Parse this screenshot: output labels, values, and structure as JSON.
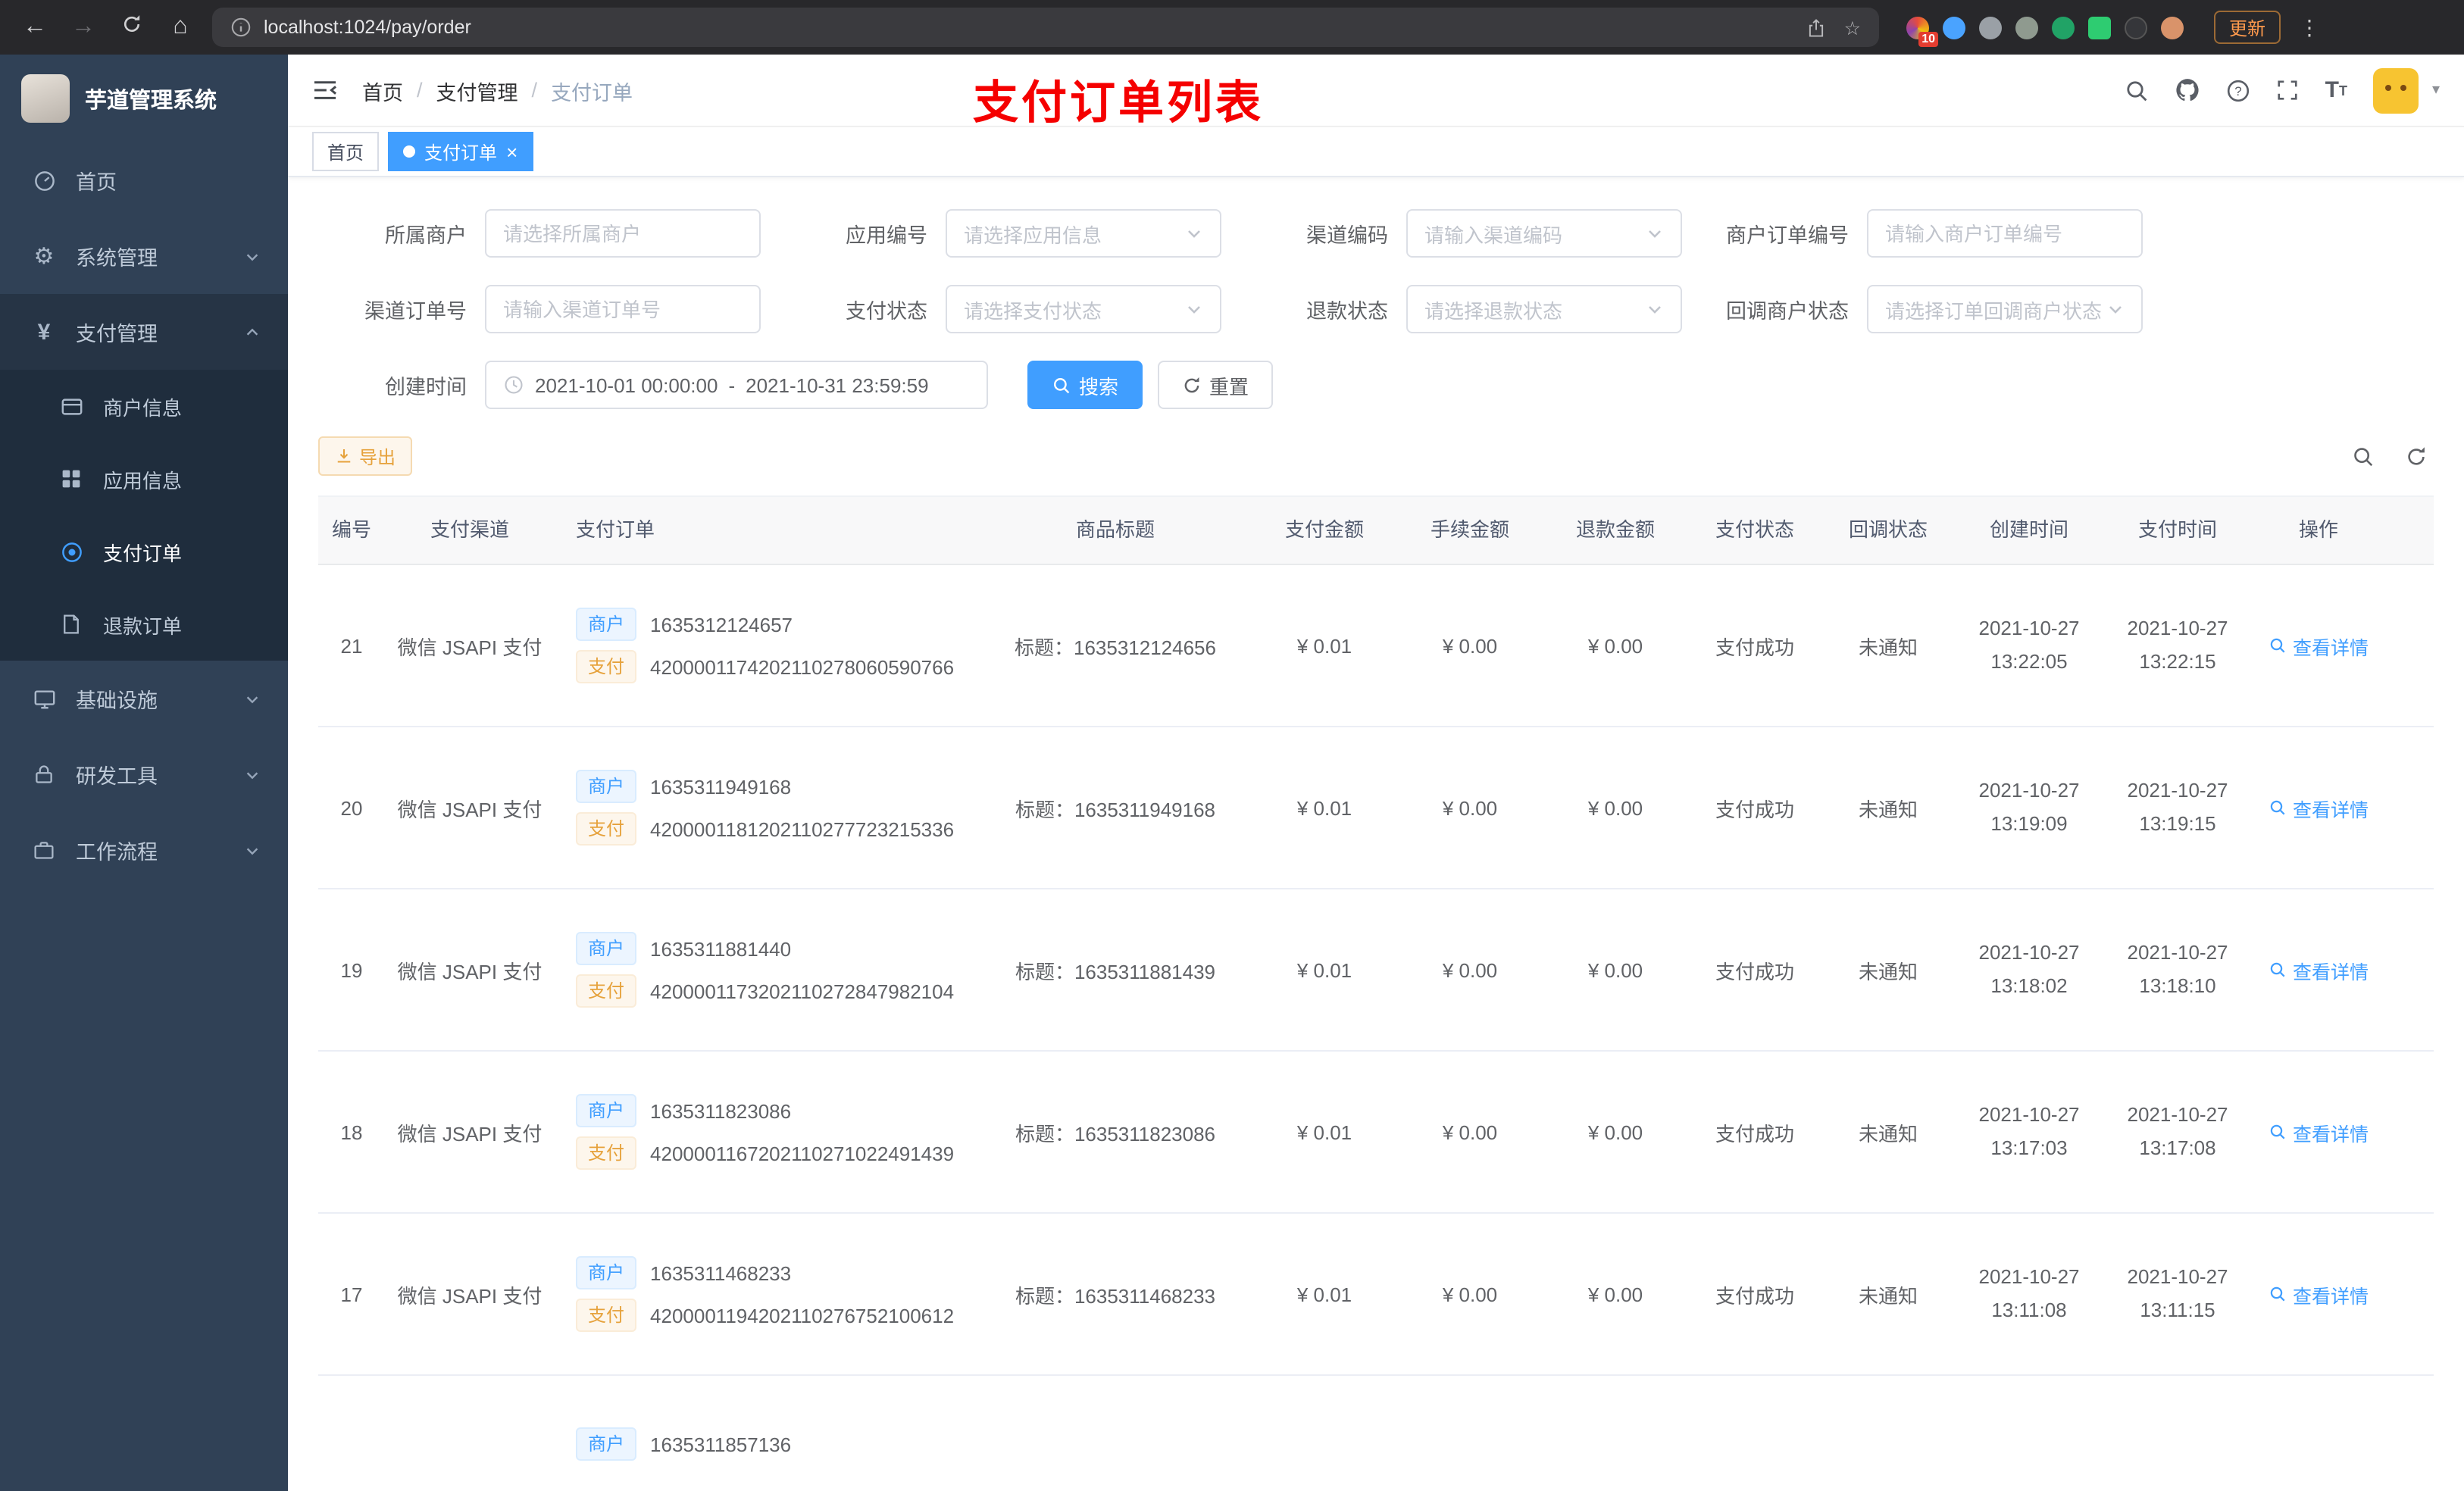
{
  "icons": {
    "back": "←",
    "forward": "→",
    "home": "⌂",
    "star": "☆",
    "dots": "⋮",
    "caret": "▾",
    "close": "×",
    "gear": "⚙",
    "yen": "¥"
  },
  "browser": {
    "url": "localhost:1024/pay/order",
    "ext_badge": "10",
    "update_label": "更新"
  },
  "sidebar": {
    "app_title": "芋道管理系统",
    "menu": [
      {
        "label": "首页"
      },
      {
        "label": "系统管理"
      },
      {
        "label": "支付管理"
      },
      {
        "label": "基础设施"
      },
      {
        "label": "研发工具"
      },
      {
        "label": "工作流程"
      }
    ],
    "submenu": [
      {
        "label": "商户信息"
      },
      {
        "label": "应用信息"
      },
      {
        "label": "支付订单"
      },
      {
        "label": "退款订单"
      }
    ]
  },
  "header": {
    "breadcrumb": [
      "首页",
      "支付管理",
      "支付订单"
    ],
    "separator": "/",
    "annotation": "支付订单列表"
  },
  "tabs": [
    {
      "label": "首页"
    },
    {
      "label": "支付订单"
    }
  ],
  "filters": {
    "fields": [
      {
        "label": "所属商户",
        "placeholder": "请选择所属商户"
      },
      {
        "label": "应用编号",
        "placeholder": "请选择应用信息"
      },
      {
        "label": "渠道编码",
        "placeholder": "请输入渠道编码"
      },
      {
        "label": "商户订单编号",
        "placeholder": "请输入商户订单编号"
      },
      {
        "label": "渠道订单号",
        "placeholder": "请输入渠道订单号"
      },
      {
        "label": "支付状态",
        "placeholder": "请选择支付状态"
      },
      {
        "label": "退款状态",
        "placeholder": "请选择退款状态"
      },
      {
        "label": "回调商户状态",
        "placeholder": "请选择订单回调商户状态"
      }
    ],
    "date": {
      "label": "创建时间",
      "start": "2021-10-01 00:00:00",
      "separator": "-",
      "end": "2021-10-31 23:59:59"
    },
    "search_label": "搜索",
    "reset_label": "重置"
  },
  "toolbar": {
    "export_label": "导出"
  },
  "table": {
    "columns": [
      "编号",
      "支付渠道",
      "支付订单",
      "商品标题",
      "支付金额",
      "手续金额",
      "退款金额",
      "支付状态",
      "回调状态",
      "创建时间",
      "支付时间",
      "操作"
    ],
    "tag_merchant": "商户",
    "tag_pay": "支付",
    "action_label": "查看详情",
    "rows": [
      {
        "id": "21",
        "channel": "微信 JSAPI 支付",
        "merchant_no": "1635312124657",
        "pay_no": "4200001174202110278060590766",
        "title": "标题：1635312124656",
        "amount": "¥ 0.01",
        "fee": "¥ 0.00",
        "refund": "¥ 0.00",
        "status": "支付成功",
        "notify": "未通知",
        "create_date": "2021-10-27",
        "create_time": "13:22:05",
        "pay_date": "2021-10-27",
        "pay_time": "13:22:15"
      },
      {
        "id": "20",
        "channel": "微信 JSAPI 支付",
        "merchant_no": "1635311949168",
        "pay_no": "4200001181202110277723215336",
        "title": "标题：1635311949168",
        "amount": "¥ 0.01",
        "fee": "¥ 0.00",
        "refund": "¥ 0.00",
        "status": "支付成功",
        "notify": "未通知",
        "create_date": "2021-10-27",
        "create_time": "13:19:09",
        "pay_date": "2021-10-27",
        "pay_time": "13:19:15"
      },
      {
        "id": "19",
        "channel": "微信 JSAPI 支付",
        "merchant_no": "1635311881440",
        "pay_no": "4200001173202110272847982104",
        "title": "标题：1635311881439",
        "amount": "¥ 0.01",
        "fee": "¥ 0.00",
        "refund": "¥ 0.00",
        "status": "支付成功",
        "notify": "未通知",
        "create_date": "2021-10-27",
        "create_time": "13:18:02",
        "pay_date": "2021-10-27",
        "pay_time": "13:18:10"
      },
      {
        "id": "18",
        "channel": "微信 JSAPI 支付",
        "merchant_no": "1635311823086",
        "pay_no": "4200001167202110271022491439",
        "title": "标题：1635311823086",
        "amount": "¥ 0.01",
        "fee": "¥ 0.00",
        "refund": "¥ 0.00",
        "status": "支付成功",
        "notify": "未通知",
        "create_date": "2021-10-27",
        "create_time": "13:17:03",
        "pay_date": "2021-10-27",
        "pay_time": "13:17:08"
      },
      {
        "id": "17",
        "channel": "微信 JSAPI 支付",
        "merchant_no": "1635311468233",
        "pay_no": "4200001194202110276752100612",
        "title": "标题：1635311468233",
        "amount": "¥ 0.01",
        "fee": "¥ 0.00",
        "refund": "¥ 0.00",
        "status": "支付成功",
        "notify": "未通知",
        "create_date": "2021-10-27",
        "create_time": "13:11:08",
        "pay_date": "2021-10-27",
        "pay_time": "13:11:15"
      }
    ],
    "partial_row": {
      "merchant_no": "1635311857136"
    }
  }
}
